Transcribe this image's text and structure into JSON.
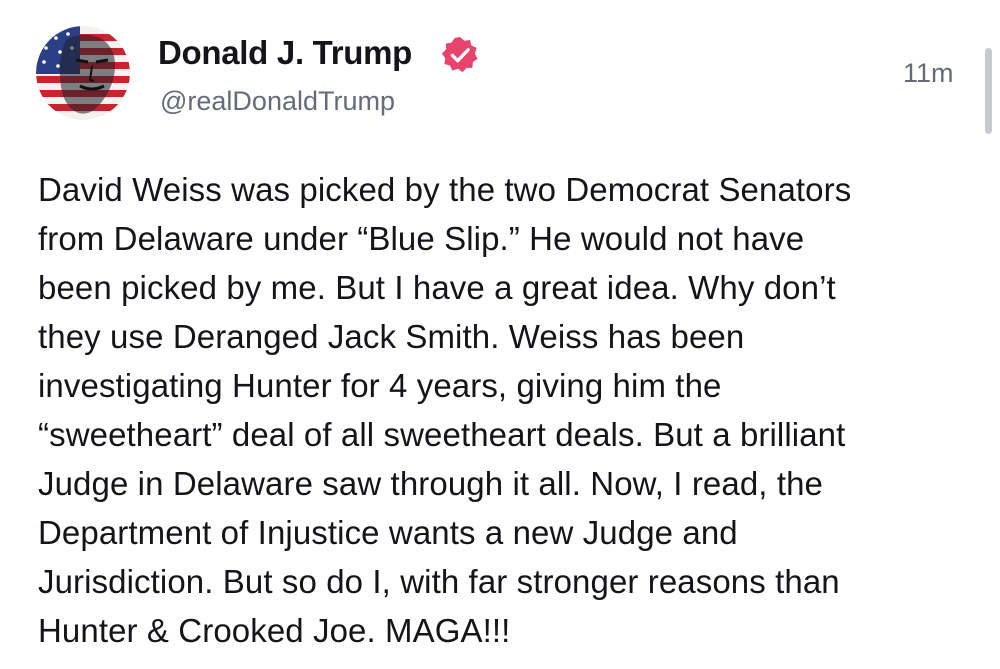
{
  "post": {
    "display_name": "Donald J. Trump",
    "handle": "@realDonaldTrump",
    "timestamp": "11m",
    "verified_icon": "verified-badge-icon",
    "body": "David Weiss was picked by the two Democrat Senators\nfrom Delaware under “Blue Slip.” He would not have\nbeen picked by me. But I have a great idea. Why don’t\nthey use Deranged Jack Smith. Weiss has been\ninvestigating Hunter for 4 years, giving him the\n“sweetheart” deal of all sweetheart deals. But a brilliant\nJudge in Delaware saw through it all. Now, I read, the\nDepartment of Injustice wants a new Judge and\nJurisdiction. But so do I, with far stronger reasons than\nHunter & Crooked Joe. MAGA!!!"
  },
  "colors": {
    "verified_badge": "#e8436c",
    "text_primary": "#141518",
    "text_secondary": "#676b78",
    "scrollbar": "#c7c9ce"
  }
}
